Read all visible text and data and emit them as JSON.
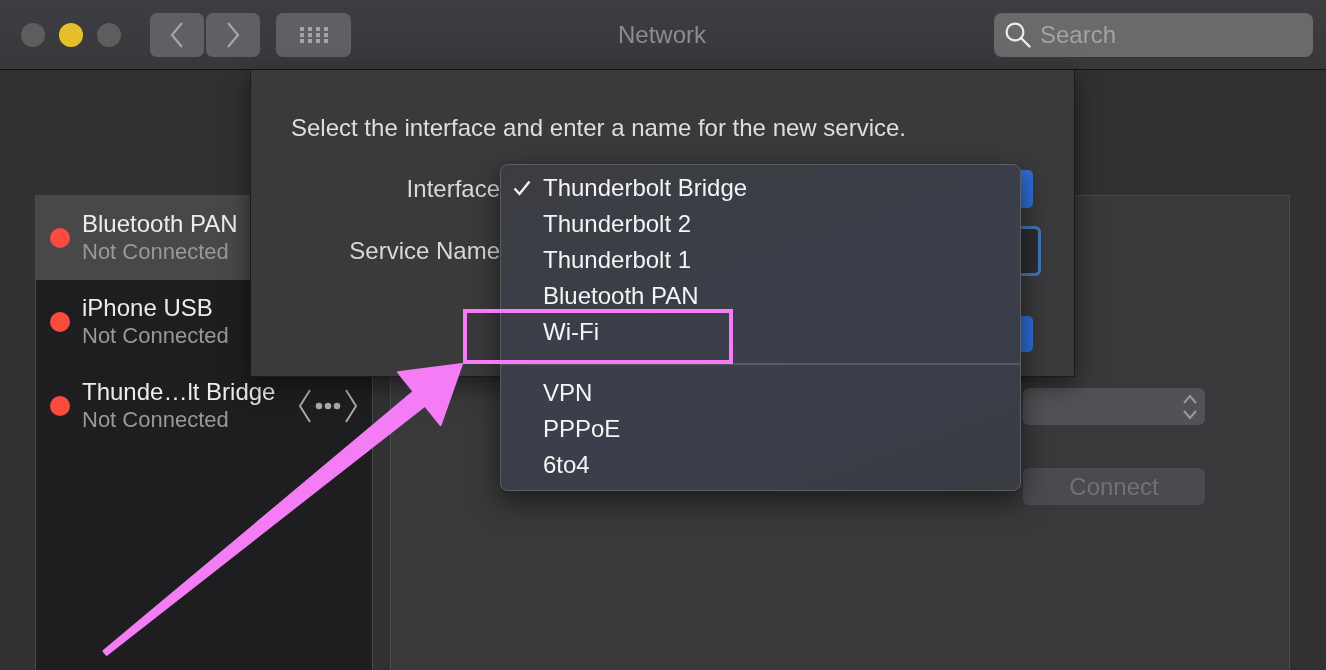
{
  "window": {
    "title": "Network",
    "controls": [
      {
        "disabled": true
      },
      {
        "disabled": false
      },
      {
        "disabled": true
      }
    ]
  },
  "toolbar": {
    "search": {
      "placeholder": "Search"
    }
  },
  "services": [
    {
      "name": "Bluetooth PAN",
      "status": "Not Connected",
      "color": "#fb4b3e",
      "selected": true,
      "kind": "plain"
    },
    {
      "name": "iPhone USB",
      "status": "Not Connected",
      "color": "#fb4b3e",
      "selected": false,
      "kind": "plain"
    },
    {
      "name": "Thunde…lt Bridge",
      "status": "Not Connected",
      "color": "#fb4b3e",
      "selected": false,
      "kind": "bridge"
    }
  ],
  "dialog": {
    "prompt": "Select the interface and enter a name for the new service.",
    "fields": [
      {
        "label": "Interface",
        "kind": "popup",
        "focused": false
      },
      {
        "label": "Service Name",
        "kind": "text",
        "focused": true
      }
    ],
    "buttons": [
      {
        "default": true
      }
    ]
  },
  "menu": {
    "sections": [
      {
        "items": [
          {
            "label": "Thunderbolt Bridge",
            "selected": true,
            "annotated": false
          },
          {
            "label": "Thunderbolt 2",
            "selected": false,
            "annotated": false
          },
          {
            "label": "Thunderbolt 1",
            "selected": false,
            "annotated": false
          },
          {
            "label": "Bluetooth PAN",
            "selected": false,
            "annotated": false
          },
          {
            "label": "Wi-Fi",
            "selected": false,
            "annotated": true
          }
        ]
      },
      {
        "items": [
          {
            "label": "VPN",
            "selected": false,
            "annotated": false
          },
          {
            "label": "PPPoE",
            "selected": false,
            "annotated": false
          },
          {
            "label": "6to4",
            "selected": false,
            "annotated": false
          }
        ]
      }
    ]
  },
  "detail": {
    "connect_button": {
      "label": "Connect",
      "disabled": true
    }
  }
}
